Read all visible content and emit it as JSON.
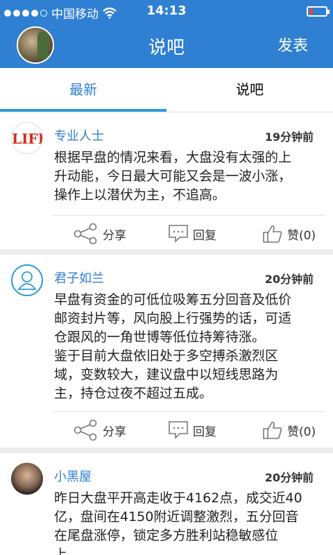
{
  "statusbar": {
    "carrier": "中国移动",
    "time": "14:13"
  },
  "header": {
    "title": "说吧",
    "post_label": "发表"
  },
  "tabs": [
    {
      "label": "最新"
    },
    {
      "label": "说吧"
    }
  ],
  "posts": [
    {
      "name": "专业人士",
      "time": "19分钟前",
      "content": "根据早盘的情况来看，大盘没有太强的上\n升动能，今日最大可能又会是一波小涨，\n操作上以潜伏为主，不追高。",
      "share_label": "分享",
      "reply_label": "回复",
      "like_label": "赞(0)"
    },
    {
      "name": "君子如兰",
      "time": "20分钟前",
      "content": "早盘有资金的可低位吸筹五分回音及低价\n邮资封片等，风向股上行强势的话，可适\n仓跟风的一角世博等低位持筹待涨。\n鉴于目前大盘依旧处于多空搏杀激烈区\n域，变数较大，建议盘中以短线思路为\n主，持仓过夜不超过五成。",
      "share_label": "分享",
      "reply_label": "回复",
      "like_label": "赞(0)"
    },
    {
      "name": "小黑屋",
      "time": "20分钟前",
      "content": "昨日大盘平开高走收于4162点，成交近40\n亿，盘间在4150附近调整激烈，五分回音\n在尾盘涨停，锁定多方胜利站稳敏感位\n上。"
    }
  ],
  "colors": {
    "header_bg": "#2f7fd2",
    "accent": "#2f7fd2",
    "indicator": "#2f9bd8"
  }
}
